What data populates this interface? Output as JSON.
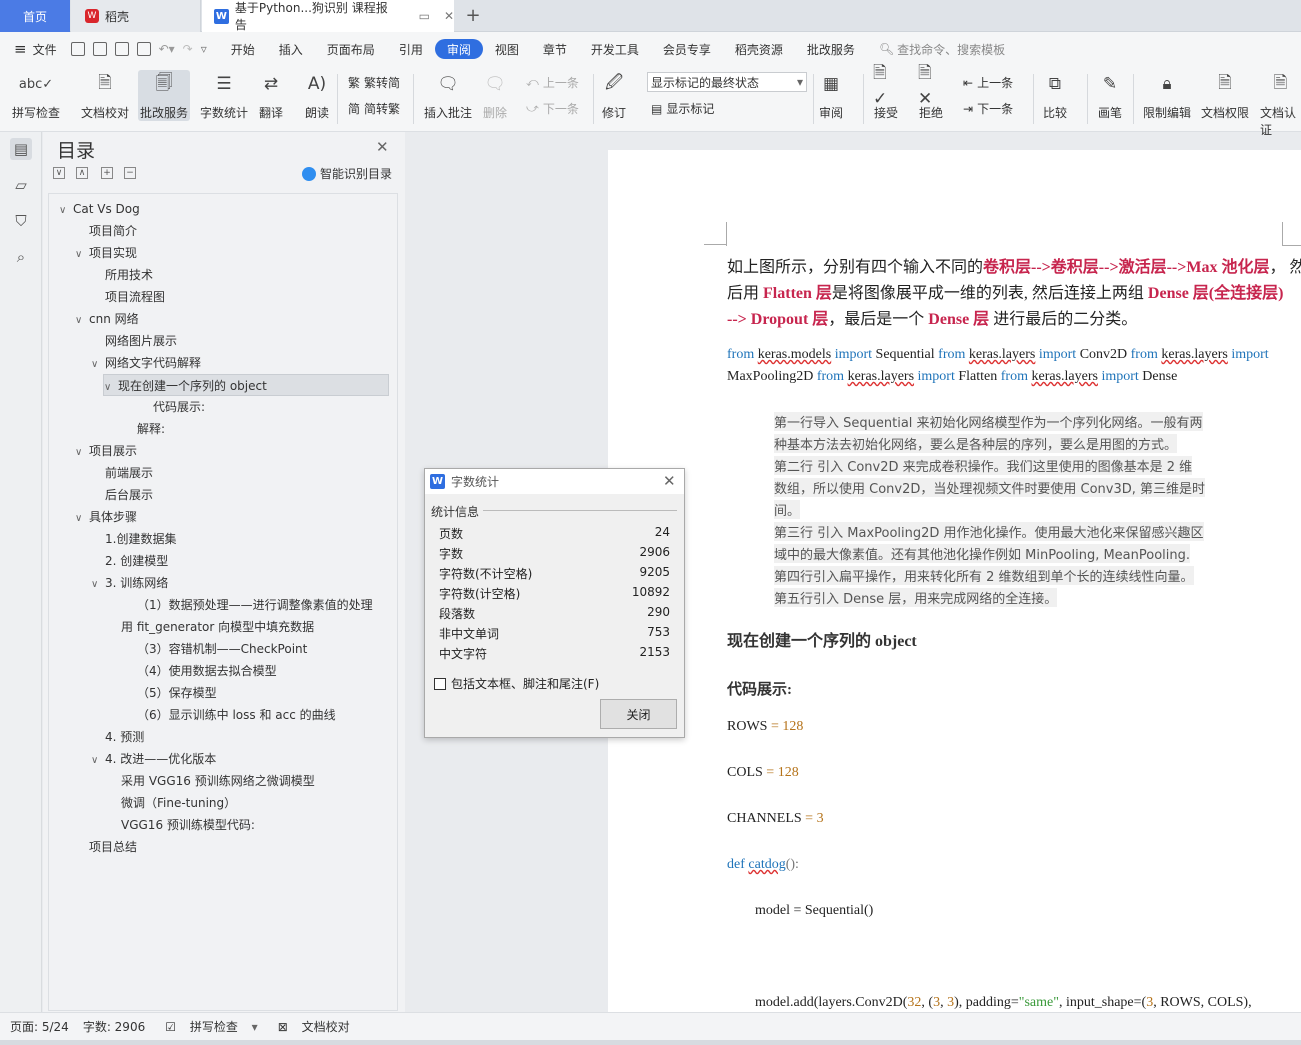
{
  "tabs": {
    "home": "首页",
    "wps": "稻壳",
    "doc": "基于Python...狗识别 课程报告"
  },
  "menu": {
    "file": "文件",
    "items": [
      "开始",
      "插入",
      "页面布局",
      "引用",
      "审阅",
      "视图",
      "章节",
      "开发工具",
      "会员专享",
      "稻壳资源",
      "批改服务"
    ],
    "active_index": 4,
    "search": "查找命令、搜索模板"
  },
  "ribbon": {
    "spell": "拼写检查",
    "proof": "文档校对",
    "review_service": "批改服务",
    "word_count": "字数统计",
    "translate": "翻译",
    "read": "朗读",
    "trad": "繁转简",
    "simp": "简转繁",
    "add_comment": "插入批注",
    "delete": "删除",
    "prev": "上一条",
    "next": "下一条",
    "revise": "修订",
    "markup_state": "显示标记的最终状态",
    "show_markup": "显示标记",
    "review": "审阅",
    "accept": "接受",
    "reject": "拒绝",
    "prev2": "上一条",
    "next2": "下一条",
    "compare": "比较",
    "pen": "画笔",
    "restrict": "限制编辑",
    "doc_rights": "文档权限",
    "doc_cert": "文档认证"
  },
  "toc": {
    "title": "目录",
    "smart": "智能识别目录",
    "items": [
      {
        "text": "Cat Vs Dog",
        "level": 0,
        "caret": "down"
      },
      {
        "text": "项目简介",
        "level": 1,
        "caret": ""
      },
      {
        "text": "项目实现",
        "level": 1,
        "caret": "down"
      },
      {
        "text": "所用技术",
        "level": 2,
        "caret": ""
      },
      {
        "text": "项目流程图",
        "level": 2,
        "caret": ""
      },
      {
        "text": "cnn  网络",
        "level": 1,
        "caret": "down"
      },
      {
        "text": "网络图片展示",
        "level": 2,
        "caret": ""
      },
      {
        "text": "网络文字代码解释",
        "level": 2,
        "caret": "down"
      },
      {
        "text": "现在创建一个序列的  object",
        "level": 3,
        "caret": "down",
        "selected": true
      },
      {
        "text": "代码展示:",
        "level": 5,
        "caret": ""
      },
      {
        "text": "解释:",
        "level": 4,
        "caret": ""
      },
      {
        "text": "项目展示",
        "level": 1,
        "caret": "down"
      },
      {
        "text": "前端展示",
        "level": 2,
        "caret": ""
      },
      {
        "text": "后台展示",
        "level": 2,
        "caret": ""
      },
      {
        "text": "具体步骤",
        "level": 1,
        "caret": "down"
      },
      {
        "text": "1.创建数据集",
        "level": 2,
        "caret": ""
      },
      {
        "text": "2.  创建模型",
        "level": 2,
        "caret": ""
      },
      {
        "text": "3.  训练网络",
        "level": 2,
        "caret": "down"
      },
      {
        "text": "（1）数据预处理——进行调整像素值的处理",
        "level": 4,
        "caret": ""
      },
      {
        "text": "用  fit_generator  向模型中填充数据",
        "level": 3,
        "caret": ""
      },
      {
        "text": "（3）容错机制——CheckPoint",
        "level": 4,
        "caret": ""
      },
      {
        "text": "（4）使用数据去拟合模型",
        "level": 4,
        "caret": ""
      },
      {
        "text": "（5）保存模型",
        "level": 4,
        "caret": ""
      },
      {
        "text": "（6）显示训练中  loss  和  acc  的曲线",
        "level": 4,
        "caret": ""
      },
      {
        "text": "4.  预测",
        "level": 2,
        "caret": ""
      },
      {
        "text": "4.  改进——优化版本",
        "level": 2,
        "caret": "down"
      },
      {
        "text": "采用  VGG16  预训练网络之微调模型",
        "level": 3,
        "caret": ""
      },
      {
        "text": "微调（Fine-tuning）",
        "level": 3,
        "caret": ""
      },
      {
        "text": "VGG16  预训练模型代码:",
        "level": 3,
        "caret": ""
      },
      {
        "text": "项目总结",
        "level": 1,
        "caret": ""
      }
    ]
  },
  "doc": {
    "p1_a": "如上图所示，分别有四个输入不同的",
    "p1_b": "卷积层-->卷积层-->激活层-->Max 池化层",
    "p1_c": "，  然",
    "p2_a": "后用",
    "p2_b": "Flatten  层",
    "p2_c": "是将图像展平成一维的列表, 然后连接上两组",
    "p2_d": "Dense  层(全连接层)",
    "p3_a": "-->  Dropout  层",
    "p3_b": "，最后是一个",
    "p3_c": "Dense 层",
    "p3_d": "进行最后的二分类。",
    "code1": [
      "from",
      "keras.models",
      "import",
      "Sequential",
      "from",
      "keras.layers",
      "import",
      "Conv2D",
      "from",
      "keras.layers",
      "import"
    ],
    "code2": [
      "MaxPooling2D",
      "from",
      "keras.layers",
      "import",
      "Flatten",
      "from",
      "keras.layers",
      "import",
      "Dense"
    ],
    "explain": [
      "第一行导入  Sequential  来初始化网络模型作为一个序列化网络。一般有两",
      "种基本方法去初始化网络，要么是各种层的序列，要么是用图的方式。",
      "第二行  引入  Conv2D  来完成卷积操作。我们这里使用的图像基本是  2  维",
      "数组，所以使用  Conv2D，当处理视频文件时要使用  Conv3D, 第三维是时",
      "间。",
      "第三行  引入  MaxPooling2D  用作池化操作。使用最大池化来保留感兴趣区",
      "域中的最大像素值。还有其他池化操作例如  MinPooling, MeanPooling.",
      "第四行引入扁平操作，用来转化所有  2  维数组到单个长的连续线性向量。",
      "第五行引入  Dense  层，用来完成网络的全连接。"
    ],
    "heading1": "现在创建一个序列的  object",
    "heading2": "代码展示:",
    "rows_name": "ROWS",
    "rows_op": " = ",
    "rows_val": "128",
    "cols_name": "COLS",
    "cols_op": " = ",
    "cols_val": "128",
    "ch_name": "CHANNELS",
    "ch_op": " = ",
    "ch_val": "3",
    "def_kw": "def",
    "def_name": "catdog",
    "def_paren": "():",
    "model_line": "model = Sequential()",
    "add_a": "model.add(layers.Conv2D(",
    "add_n1": "32",
    "add_b": ", (",
    "add_n2": "3",
    "add_c": ", ",
    "add_n3": "3",
    "add_d": "), padding=",
    "add_s": "\"same\"",
    "add_e": ", input_shape=(",
    "add_n4": "3",
    "add_f": ", ROWS, COLS),"
  },
  "dialog": {
    "title": "字数统计",
    "group": "统计信息",
    "stats": [
      {
        "label": "页数",
        "value": "24"
      },
      {
        "label": "字数",
        "value": "2906"
      },
      {
        "label": "字符数(不计空格)",
        "value": "9205"
      },
      {
        "label": "字符数(计空格)",
        "value": "10892"
      },
      {
        "label": "段落数",
        "value": "290"
      },
      {
        "label": "非中文单词",
        "value": "753"
      },
      {
        "label": "中文字符",
        "value": "2153"
      }
    ],
    "checkbox": "包括文本框、脚注和尾注(F)",
    "close": "关闭"
  },
  "status": {
    "page": "页面: 5/24",
    "words": "字数: 2906",
    "spell": "拼写检查",
    "proof": "文档校对"
  }
}
